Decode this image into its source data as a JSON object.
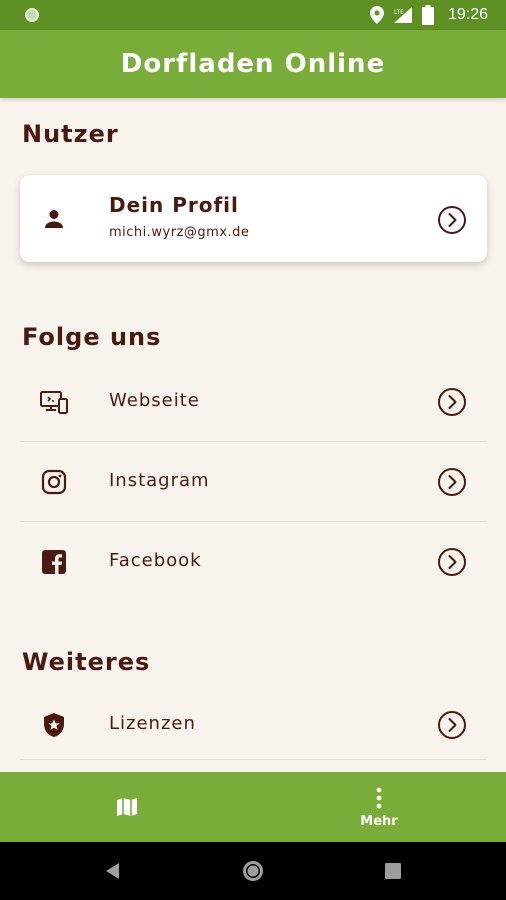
{
  "status_bar": {
    "time": "19:26",
    "network": "LTE"
  },
  "app_bar": {
    "title": "Dorfladen Online"
  },
  "sections": {
    "user": "Nutzer",
    "follow": "Folge uns",
    "more": "Weiteres"
  },
  "profile": {
    "name": "Dein Profil",
    "email": "michi.wyrz@gmx.de",
    "icon": "person-icon"
  },
  "follow_items": [
    {
      "label": "Webseite",
      "icon": "devices-icon"
    },
    {
      "label": "Instagram",
      "icon": "instagram-icon"
    },
    {
      "label": "Facebook",
      "icon": "facebook-icon"
    }
  ],
  "more_items": [
    {
      "label": "Lizenzen",
      "icon": "shield-star-icon"
    }
  ],
  "bottom_nav": [
    {
      "label": "",
      "icon": "map-icon"
    },
    {
      "label": "Mehr",
      "icon": "more-vert-icon"
    }
  ],
  "colors": {
    "primary": "#7aac3a",
    "status_bar": "#5e8f22",
    "text": "#4a1a10",
    "background": "#f8f3ec"
  }
}
